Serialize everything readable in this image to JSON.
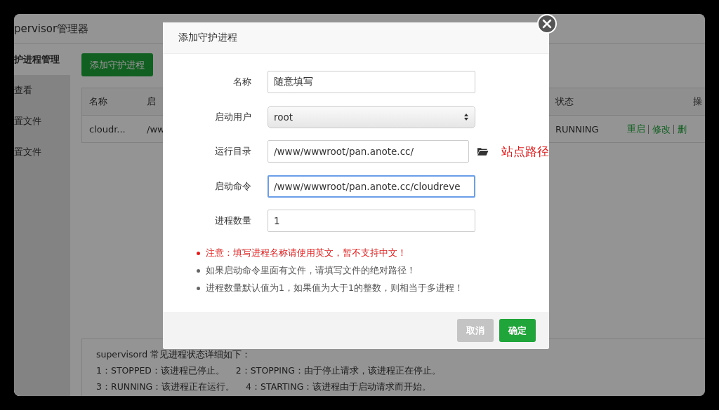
{
  "app": {
    "title": "pervisor管理器"
  },
  "sidebar": {
    "items": [
      {
        "label": "护进程管理",
        "selected": true
      },
      {
        "label": "查看",
        "selected": false
      },
      {
        "label": "置文件",
        "selected": false
      },
      {
        "label": "置文件",
        "selected": false
      }
    ]
  },
  "add_button": "添加守护进程",
  "table": {
    "columns": [
      "名称",
      "启",
      "状态",
      "操"
    ],
    "rows": [
      {
        "cells": [
          "cloudr...",
          "/ww",
          "RUNNING"
        ],
        "actions": [
          "重启",
          "修改",
          "删"
        ]
      }
    ]
  },
  "info": {
    "lines": [
      "supervisord 常见进程状态详细如下：",
      "1：STOPPED：该进程已停止。    2：STOPPING：由于停止请求，该进程正在停止。",
      "3：RUNNING：该进程正在运行。    4：STARTING：该进程由于启动请求而开始。"
    ]
  },
  "dialog": {
    "title": "添加守护进程",
    "fields": [
      {
        "label": "名称",
        "kind": "text",
        "value": "随意填写",
        "focused": false
      },
      {
        "label": "启动用户",
        "kind": "select",
        "value": "root",
        "focused": false
      },
      {
        "label": "运行目录",
        "kind": "path",
        "value": "/www/wwwroot/pan.anote.cc/",
        "focused": false,
        "annotation": "站点路径"
      },
      {
        "label": "启动命令",
        "kind": "text",
        "value": "/www/wwwroot/pan.anote.cc/cloudreve",
        "focused": true
      },
      {
        "label": "进程数量",
        "kind": "text",
        "value": "1",
        "focused": false
      }
    ],
    "notes": [
      {
        "text": "注意：填写进程名称请使用英文，暂不支持中文！",
        "kind": "warning"
      },
      {
        "text": "如果启动命令里面有文件，请填写文件的绝对路径！",
        "kind": "info"
      },
      {
        "text": "进程数量默认值为1，如果值为大于1的整数，则相当于多进程！",
        "kind": "info"
      }
    ],
    "buttons": [
      {
        "label": "取消",
        "kind": "cancel"
      },
      {
        "label": "确定",
        "kind": "primary"
      }
    ]
  }
}
